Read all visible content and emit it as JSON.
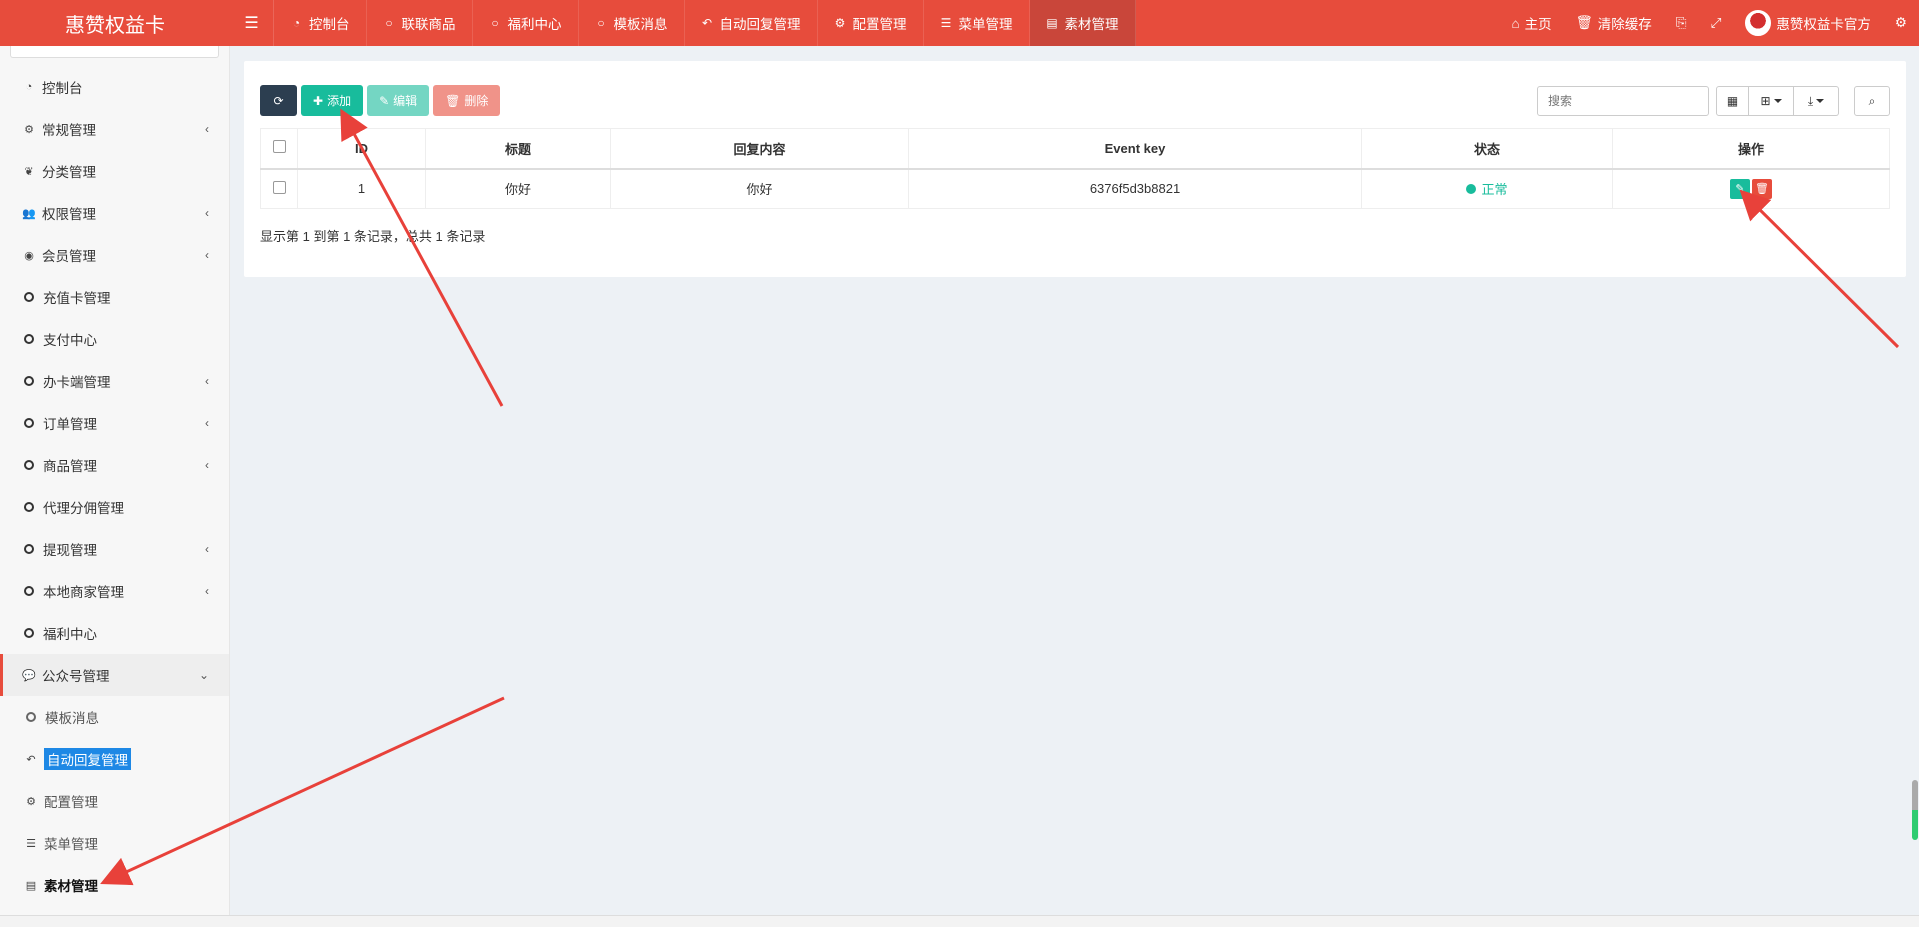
{
  "brand": "惠赞权益卡",
  "topnav": {
    "tabs": [
      {
        "icon": "dashboard-icon",
        "label": "控制台",
        "active": false
      },
      {
        "icon": "circle-icon",
        "label": "联联商品",
        "active": false
      },
      {
        "icon": "circle-icon",
        "label": "福利中心",
        "active": false
      },
      {
        "icon": "circle-icon",
        "label": "模板消息",
        "active": false
      },
      {
        "icon": "reply-icon",
        "label": "自动回复管理",
        "active": false
      },
      {
        "icon": "gear-icon",
        "label": "配置管理",
        "active": false
      },
      {
        "icon": "list-icon",
        "label": "菜单管理",
        "active": false
      },
      {
        "icon": "list-alt-icon",
        "label": "素材管理",
        "active": true
      }
    ],
    "right": {
      "home": "主页",
      "clear_cache": "清除缓存",
      "username": "惠赞权益卡官方"
    }
  },
  "sidebar": {
    "items": [
      {
        "label": "控制台",
        "icon": "dashboard-icon",
        "has_children": false
      },
      {
        "label": "常规管理",
        "icon": "cogs-icon",
        "has_children": true
      },
      {
        "label": "分类管理",
        "icon": "leaf-icon",
        "has_children": false
      },
      {
        "label": "权限管理",
        "icon": "group-icon",
        "has_children": true
      },
      {
        "label": "会员管理",
        "icon": "user-circle-icon",
        "has_children": true
      },
      {
        "label": "充值卡管理",
        "icon": "circle-icon",
        "has_children": false
      },
      {
        "label": "支付中心",
        "icon": "circle-icon",
        "has_children": false
      },
      {
        "label": "办卡端管理",
        "icon": "circle-icon",
        "has_children": true
      },
      {
        "label": "订单管理",
        "icon": "circle-icon",
        "has_children": true
      },
      {
        "label": "商品管理",
        "icon": "circle-icon",
        "has_children": true
      },
      {
        "label": "代理分佣管理",
        "icon": "circle-icon",
        "has_children": false
      },
      {
        "label": "提现管理",
        "icon": "circle-icon",
        "has_children": true
      },
      {
        "label": "本地商家管理",
        "icon": "circle-icon",
        "has_children": true
      },
      {
        "label": "福利中心",
        "icon": "circle-icon",
        "has_children": false
      }
    ],
    "open_group": {
      "label": "公众号管理",
      "icon": "wechat-icon",
      "children": [
        {
          "label": "模板消息",
          "icon": "circle-icon"
        },
        {
          "label": "自动回复管理",
          "icon": "reply-icon"
        },
        {
          "label": "配置管理",
          "icon": "gear-icon"
        },
        {
          "label": "菜单管理",
          "icon": "list-icon"
        },
        {
          "label": "素材管理",
          "icon": "list-alt-icon"
        }
      ]
    }
  },
  "toolbar": {
    "add_label": "添加",
    "edit_label": "编辑",
    "delete_label": "删除",
    "search_placeholder": "搜索"
  },
  "table": {
    "headers": [
      "ID",
      "标题",
      "回复内容",
      "Event key",
      "状态",
      "操作"
    ],
    "rows": [
      {
        "id": "1",
        "title": "你好",
        "content": "你好",
        "event_key": "6376f5d3b8821",
        "status": "正常"
      }
    ]
  },
  "pagination_text": "显示第 1 到第 1 条记录，总共 1 条记录",
  "colors": {
    "primary_red": "#e74c3c",
    "success": "#18bc9c",
    "dark": "#2c3e50"
  }
}
